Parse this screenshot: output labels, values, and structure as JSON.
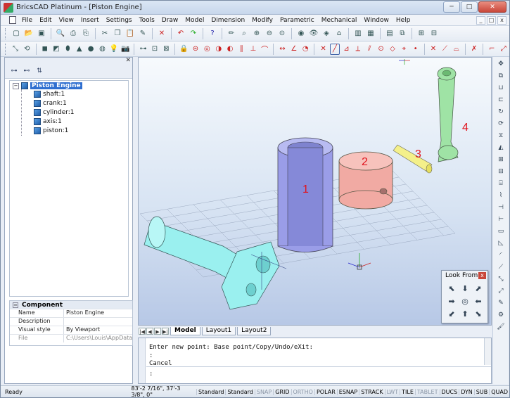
{
  "window": {
    "title": "BricsCAD Platinum - [Piston Engine]",
    "controls": [
      "─",
      "□",
      "✕"
    ]
  },
  "menu": {
    "items": [
      "File",
      "Edit",
      "View",
      "Insert",
      "Settings",
      "Tools",
      "Draw",
      "Model",
      "Dimension",
      "Modify",
      "Parametric",
      "Mechanical",
      "Window",
      "Help"
    ],
    "doc_controls": [
      "_",
      "□",
      "x"
    ]
  },
  "panel": {
    "close": "✕",
    "tree": {
      "root": "Piston Engine",
      "children": [
        "shaft:1",
        "crank:1",
        "cylinder:1",
        "axis:1",
        "piston:1"
      ]
    },
    "properties": {
      "header": "Component",
      "rows": [
        {
          "key": "Name",
          "value": "Piston Engine"
        },
        {
          "key": "Description",
          "value": ""
        },
        {
          "key": "Visual style",
          "value": "By Viewport"
        },
        {
          "key": "File",
          "value": "C:\\Users\\Louis\\AppData"
        }
      ]
    }
  },
  "viewport": {
    "labels": [
      "1",
      "2",
      "3",
      "4"
    ],
    "colors": {
      "cylinder": "#9a9de8",
      "piston": "#f1aaa3",
      "pin": "#f4f08a",
      "rod": "#9fe3a5",
      "shaft": "#9af0ef",
      "label": "#e0141e"
    }
  },
  "lookfrom": {
    "title": "Look From",
    "close": "x",
    "arrows": [
      "⬉",
      "⬇",
      "⬈",
      "➡",
      "◎",
      "⬅",
      "⬋",
      "⬆",
      "⬊"
    ]
  },
  "tabs": {
    "nav": [
      "|◀",
      "◀",
      "▶",
      "▶|"
    ],
    "items": [
      "Model",
      "Layout1",
      "Layout2"
    ]
  },
  "command": {
    "history": [
      "Enter new point: Base point/Copy/Undo/eXit:",
      ":",
      "Cancel"
    ],
    "prompt": ":"
  },
  "status": {
    "ready": "Ready",
    "coords": "83'-2 7/16\", 37'-3 3/8\", 0\"",
    "styles": [
      "Standard",
      "Standard"
    ],
    "toggles": [
      {
        "label": "SNAP",
        "on": false
      },
      {
        "label": "GRID",
        "on": true
      },
      {
        "label": "ORTHO",
        "on": false
      },
      {
        "label": "POLAR",
        "on": true
      },
      {
        "label": "ESNAP",
        "on": true
      },
      {
        "label": "STRACK",
        "on": true
      },
      {
        "label": "LWT",
        "on": false
      },
      {
        "label": "TILE",
        "on": true
      },
      {
        "label": "TABLET",
        "on": false
      },
      {
        "label": "DUCS",
        "on": true
      },
      {
        "label": "DYN",
        "on": true
      },
      {
        "label": "SUB",
        "on": true
      },
      {
        "label": "QUAD",
        "on": true
      }
    ]
  },
  "toolbar1_icons": [
    "new-icon",
    "open-icon",
    "save-icon",
    "print-preview-icon",
    "print-icon",
    "plot-icon",
    "cut-icon",
    "copy-icon",
    "paste-icon",
    "match-props-icon",
    "delete-icon",
    "undo-icon",
    "redo-icon",
    "help-icon",
    "pencil-icon",
    "zoom-icon",
    "zoom-in-icon",
    "zoom-out-icon",
    "zoom-window-icon",
    "render-icon",
    "layers-icon",
    "view-icon",
    "layout-icon"
  ],
  "toolbar2_icons": [
    "ucs-icon",
    "solid-icon",
    "box-icon",
    "cylinder-icon",
    "cone-icon",
    "sphere-icon",
    "light-icon",
    "camera-icon",
    "snap-endpoint-icon",
    "snap-midpoint-icon",
    "snap-center-icon",
    "snap-node-icon",
    "snap-quadrant-icon",
    "snap-intersection-icon",
    "snap-tangent-icon",
    "snap-nearest-icon",
    "snap-clear-icon"
  ]
}
